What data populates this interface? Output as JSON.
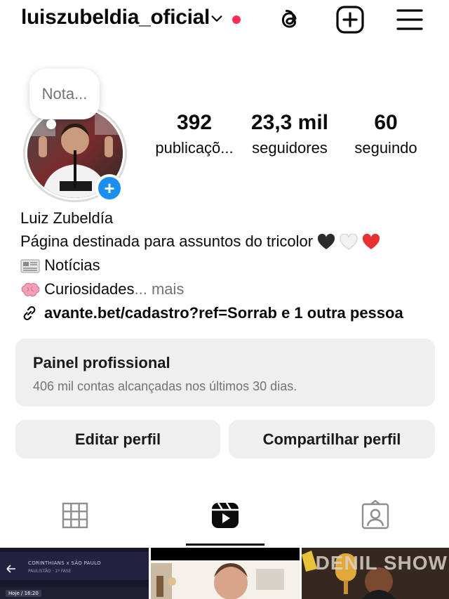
{
  "header": {
    "username": "luiszubeldia_oficial",
    "notification_color": "#ff2d55",
    "icons": [
      "chevron-down-icon",
      "threads-icon",
      "new-post-icon",
      "menu-icon"
    ]
  },
  "profile": {
    "note_placeholder": "Nota...",
    "stats": [
      {
        "value": "392",
        "label": "publicaçõ..."
      },
      {
        "value": "23,3 mil",
        "label": "seguidores"
      },
      {
        "value": "60",
        "label": "seguindo"
      }
    ]
  },
  "bio": {
    "name": "Luiz Zubeldía",
    "description": "Página destinada para assuntos do tricolor",
    "line2": "Notícias",
    "line3": "Curiosidades",
    "more": "... mais",
    "link": "avante.bet/cadastro?ref=Sorrab e 1 outra pessoa"
  },
  "dashboard": {
    "title": "Painel profissional",
    "subtitle": "406 mil contas alcançadas nos últimos 30 dias."
  },
  "actions": {
    "edit": "Editar perfil",
    "share": "Compartilhar perfil"
  },
  "tabs": [
    "grid-icon",
    "reels-icon",
    "tagged-icon"
  ],
  "thumbnails": {
    "t1_title": "CORINTHIANS x SÃO PAULO",
    "t1_sub": "PAULISTÃO · 1ª FASE",
    "t1_time": "Hoje / 16:20",
    "t3_text": "DENIL SHOW"
  }
}
